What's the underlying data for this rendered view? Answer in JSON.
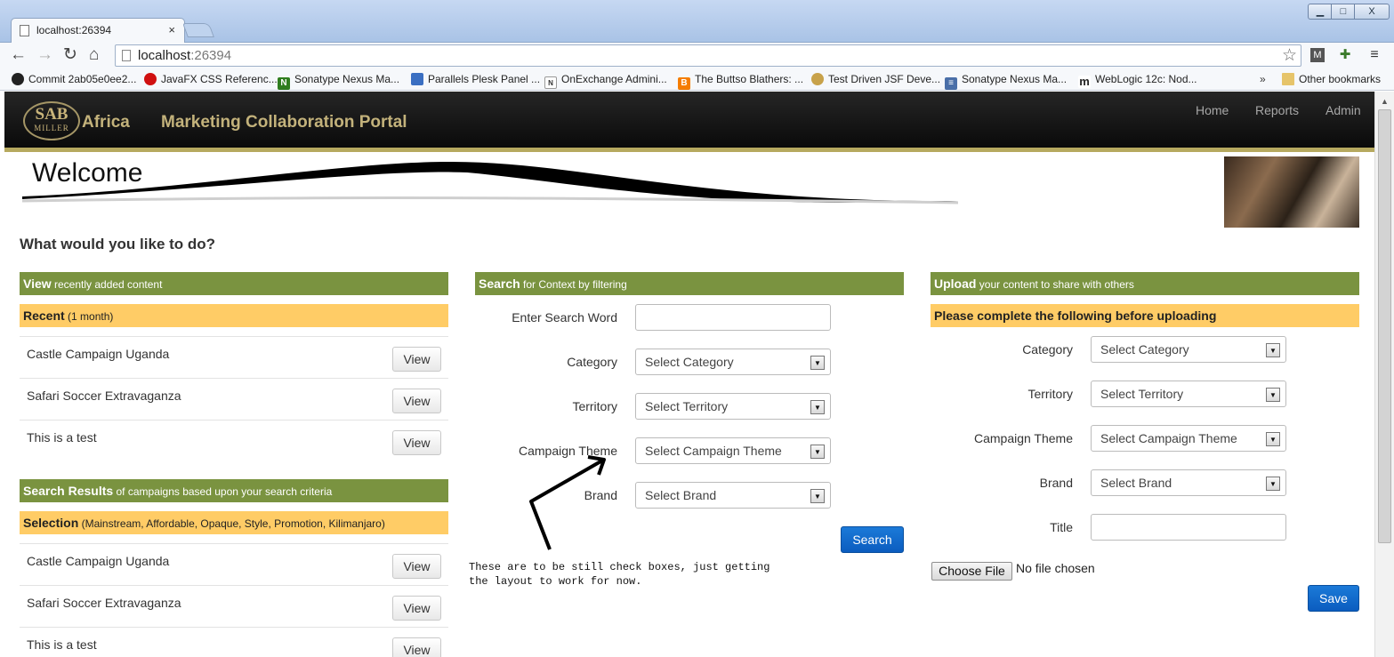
{
  "browser": {
    "tab_title": "localhost:26394",
    "tab_close": "×",
    "url_host": "localhost",
    "url_port": ":26394",
    "window_controls": {
      "minimize": "▁",
      "maximize": "□",
      "close": "X"
    },
    "bookmarks": [
      {
        "label": "Commit 2ab05e0ee2...",
        "icon": "github-icon"
      },
      {
        "label": "JavaFX CSS Referenc...",
        "icon": "oracle-icon"
      },
      {
        "label": "Sonatype Nexus Ma...",
        "icon": "nexus-icon"
      },
      {
        "label": "Parallels Plesk Panel ...",
        "icon": "plesk-icon"
      },
      {
        "label": "OnExchange Admini...",
        "icon": "net-icon"
      },
      {
        "label": "The Buttso Blathers: ...",
        "icon": "blogger-icon"
      },
      {
        "label": "Test Driven JSF Deve...",
        "icon": "book-icon"
      },
      {
        "label": "Sonatype Nexus Ma...",
        "icon": "nexus-list-icon"
      },
      {
        "label": "WebLogic 12c: Nod...",
        "icon": "m-icon"
      }
    ],
    "bookmarks_overflow": "»",
    "other_bookmarks": "Other bookmarks"
  },
  "header": {
    "logo_line1": "SAB",
    "logo_line2": "MILLER",
    "region": "Africa",
    "title": "Marketing Collaboration Portal",
    "nav": [
      "Home",
      "Reports",
      "Admin"
    ]
  },
  "welcome": "Welcome",
  "question": "What would you like to do?",
  "view_panel": {
    "heading_bold": "View",
    "heading_rest": " recently added content",
    "recent_bold": "Recent",
    "recent_rest": " (1 month)",
    "recent_items": [
      "Castle Campaign Uganda",
      "Safari Soccer Extravaganza",
      "This is a test"
    ],
    "view_label": "View",
    "results_bold": "Search Results",
    "results_rest": " of campaigns based upon your search criteria",
    "selection_bold": "Selection",
    "selection_rest": " (Mainstream, Affordable, Opaque, Style, Promotion, Kilimanjaro)",
    "result_items": [
      "Castle Campaign Uganda",
      "Safari Soccer Extravaganza",
      "This is a test"
    ]
  },
  "search_panel": {
    "heading_bold": "Search",
    "heading_rest": " for Context by filtering",
    "search_word_label": "Enter Search Word",
    "search_word_value": "",
    "category_label": "Category",
    "category_value": "Select Category",
    "territory_label": "Territory",
    "territory_value": "Select Territory",
    "theme_label": "Campaign Theme",
    "theme_value": "Select Campaign Theme",
    "brand_label": "Brand",
    "brand_value": "Select Brand",
    "search_button": "Search",
    "note_line1": "These are to be still check boxes, just getting",
    "note_line2": "the layout to work for now."
  },
  "upload_panel": {
    "heading_bold": "Upload",
    "heading_rest": " your content to share with others",
    "subheading": "Please complete the following before uploading",
    "category_label": "Category",
    "category_value": "Select Category",
    "territory_label": "Territory",
    "territory_value": "Select Territory",
    "theme_label": "Campaign Theme",
    "theme_value": "Select Campaign Theme",
    "brand_label": "Brand",
    "brand_value": "Select Brand",
    "title_label": "Title",
    "title_value": "",
    "choose_file": "Choose File",
    "no_file": "No file chosen",
    "save_button": "Save"
  },
  "colors": {
    "green_bar": "#7a9340",
    "yellow_bar": "#ffcc66",
    "header_gold": "#c3b27b",
    "primary_blue": "#0b5cbf"
  }
}
